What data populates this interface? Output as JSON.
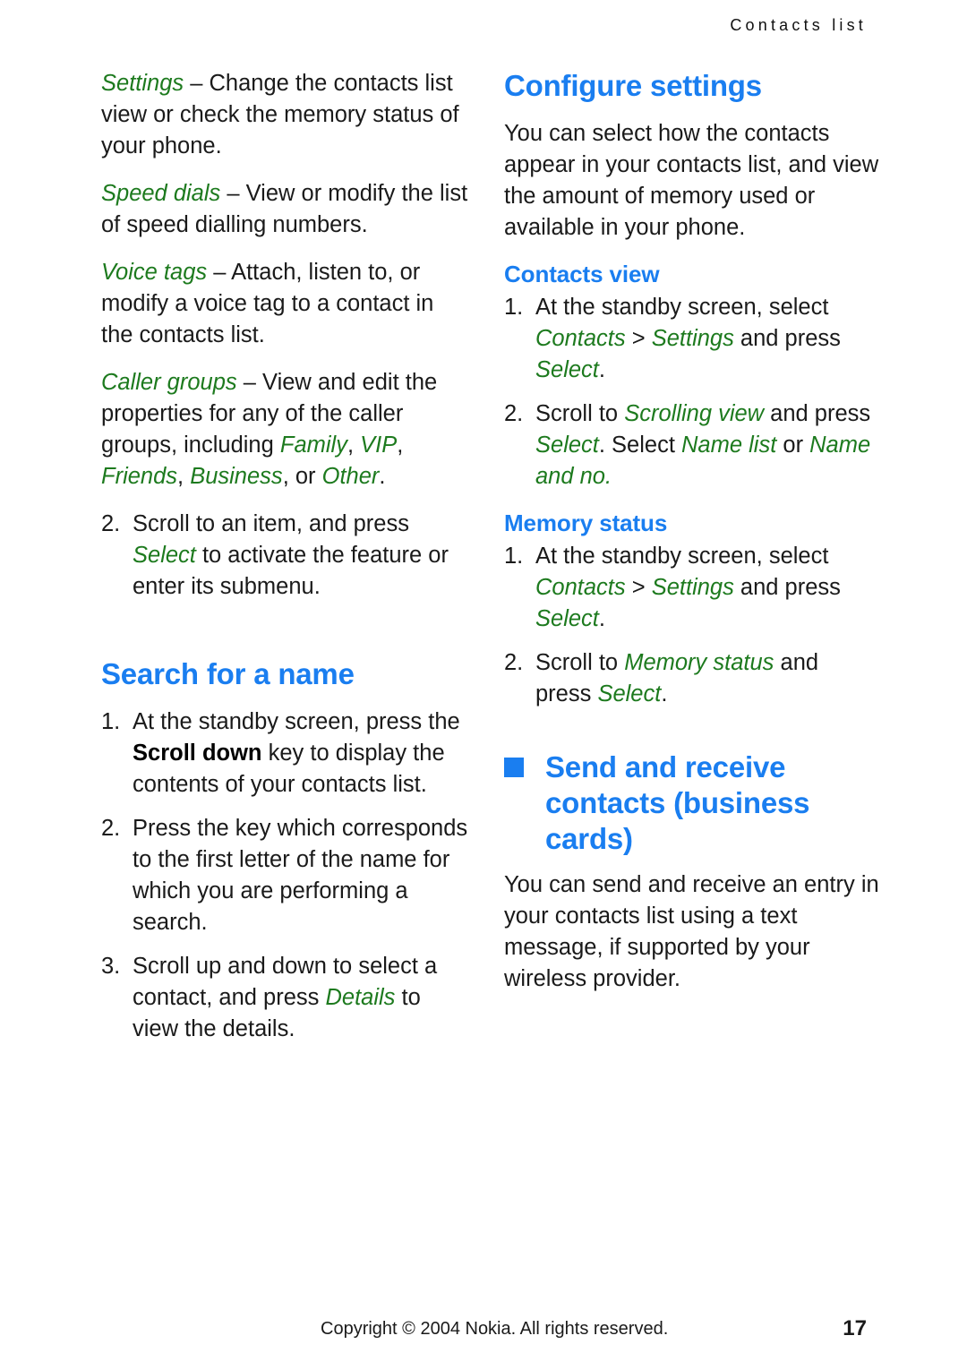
{
  "header": {
    "running_title": "Contacts list"
  },
  "colors": {
    "heading_blue": "#1a7ef0",
    "term_green": "#1d7a1e",
    "body_black": "#1a1a1a"
  },
  "left_column": {
    "settings_term": "Settings",
    "settings_dash": " – ",
    "settings_desc": "Change the contacts list view or check the memory status of your phone.",
    "speed_dials_term": "Speed dials",
    "speed_dials_dash": " – ",
    "speed_dials_desc": "View or modify the list of speed dialling numbers.",
    "voice_tags_term": "Voice tags",
    "voice_tags_dash": " – ",
    "voice_tags_desc": "Attach, listen to, or modify a voice tag to a contact in the contacts list.",
    "caller_groups_term": "Caller groups",
    "caller_groups_dash": " – ",
    "caller_groups_desc_a": "View and edit the properties for any of the caller groups, including ",
    "caller_groups_g1": "Family",
    "caller_groups_sep1": ", ",
    "caller_groups_g2": "VIP",
    "caller_groups_sep2": ", ",
    "caller_groups_g3": "Friends",
    "caller_groups_sep3": ", ",
    "caller_groups_g4": "Business",
    "caller_groups_sep4": ", or ",
    "caller_groups_g5": "Other",
    "caller_groups_end": ".",
    "item2_num": "2.",
    "item2_a": "Scroll to an item, and press ",
    "item2_select": "Select",
    "item2_b": " to activate the feature or enter its submenu.",
    "search_heading": "Search for a name",
    "search_steps": [
      {
        "num": "1.",
        "a": "At the standby screen, press the ",
        "bold": "Scroll down",
        "b": " key to display the contents of your contacts list."
      },
      {
        "num": "2.",
        "a": "Press the key which corresponds to the first letter of the name for which you are performing a search.",
        "bold": "",
        "b": ""
      }
    ],
    "step3_num": "3.",
    "step3_a": "Scroll up and down to select a contact, and press ",
    "step3_details": "Details",
    "step3_b": " to view the details."
  },
  "right_column": {
    "configure_heading": "Configure settings",
    "configure_para": "You can select how the contacts appear in your contacts list, and view the amount of memory used or available in your phone.",
    "contacts_view_heading": "Contacts view",
    "cv_step1_num": "1.",
    "cv_step1_a": "At the standby screen, select ",
    "cv_step1_contacts": "Contacts",
    "cv_step1_gt": " > ",
    "cv_step1_settings": "Settings",
    "cv_step1_b": " and press ",
    "cv_step1_select": "Select",
    "cv_step1_end": ".",
    "cv_step2_num": "2.",
    "cv_step2_a": "Scroll to ",
    "cv_step2_scrolling": "Scrolling view",
    "cv_step2_b": " and press ",
    "cv_step2_select1": "Select",
    "cv_step2_c": ". Select ",
    "cv_step2_namelist": "Name list",
    "cv_step2_d": " or ",
    "cv_step2_nameandno": "Name and no.",
    "memory_status_heading": "Memory status",
    "ms_step1_num": "1.",
    "ms_step1_a": "At the standby screen, select ",
    "ms_step1_contacts": "Contacts",
    "ms_step1_gt": " > ",
    "ms_step1_settings": "Settings",
    "ms_step1_b": " and press ",
    "ms_step1_select": "Select",
    "ms_step1_end": ".",
    "ms_step2_num": "2.",
    "ms_step2_a": "Scroll to ",
    "ms_step2_memory": "Memory status",
    "ms_step2_b": " and press ",
    "ms_step2_select": "Select",
    "ms_step2_end": ".",
    "send_heading": "Send and receive contacts (business cards)",
    "send_para": "You can send and receive an entry in your contacts list using a text message, if supported by your wireless provider."
  },
  "footer": {
    "copyright": "Copyright © 2004 Nokia. All rights reserved.",
    "page_number": "17"
  }
}
